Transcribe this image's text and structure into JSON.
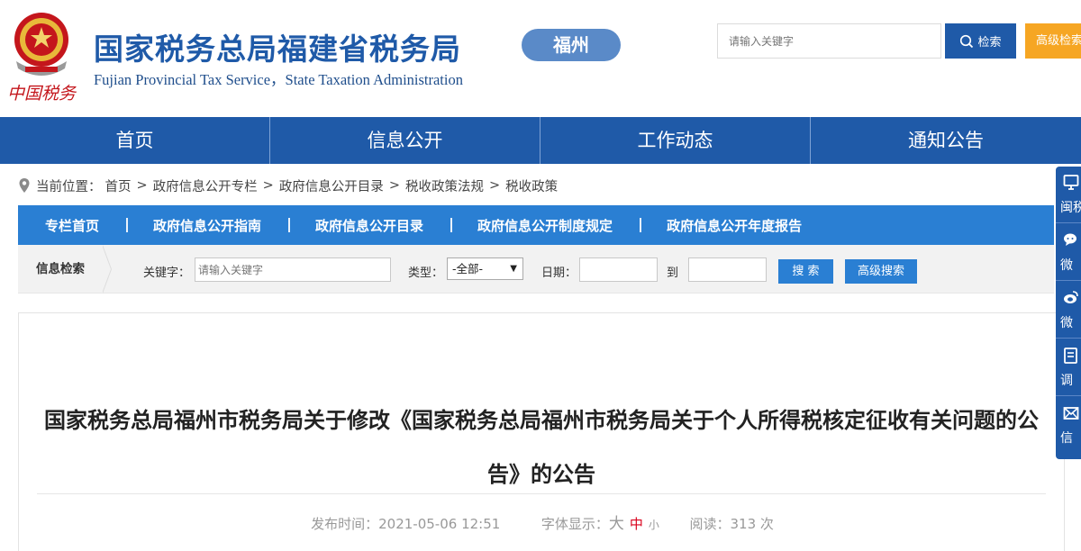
{
  "header": {
    "logo_text": "中国税务",
    "title": "国家税务总局福建省税务局",
    "subtitle": "Fujian Provincial Tax Service，State Taxation Administration",
    "city_badge": "福州",
    "search": {
      "placeholder": "请输入关键字",
      "button_label": "检索",
      "advanced_label": "高级检索"
    }
  },
  "nav": {
    "items": [
      "首页",
      "信息公开",
      "工作动态",
      "通知公告"
    ]
  },
  "breadcrumb": {
    "prefix": "当前位置：",
    "items": [
      "首页",
      "政府信息公开专栏",
      "政府信息公开目录",
      "税收政策法规",
      "税收政策"
    ],
    "separator": ">"
  },
  "subnav": {
    "items": [
      "专栏首页",
      "政府信息公开指南",
      "政府信息公开目录",
      "政府信息公开制度规定",
      "政府信息公开年度报告"
    ]
  },
  "info_search": {
    "label": "信息检索",
    "keyword_label": "关键字：",
    "keyword_placeholder": "请输入关键字",
    "type_label": "类型：",
    "type_selected": "-全部-",
    "date_label": "日期：",
    "date_to_label": "到",
    "search_button": "搜 索",
    "advanced_button": "高级搜索"
  },
  "article": {
    "title": "国家税务总局福州市税务局关于修改《国家税务总局福州市税务局关于个人所得税核定征收有关问题的公告》的公告",
    "publish_label": "发布时间：",
    "publish_time": "2021-05-06 12:51",
    "font_label": "字体显示：",
    "font_large": "大",
    "font_medium": "中",
    "font_small": "小",
    "reads_label": "阅读：",
    "reads_value": "313 次"
  },
  "floatbar": {
    "items": [
      {
        "label": "闽税",
        "icon": "monitor-icon"
      },
      {
        "label": "微",
        "icon": "chat-bubble-icon"
      },
      {
        "label": "微",
        "icon": "weibo-icon"
      },
      {
        "label": "调",
        "icon": "survey-icon"
      },
      {
        "label": "信",
        "icon": "mail-icon"
      }
    ]
  },
  "colors": {
    "primary": "#1f5aa8",
    "subnav": "#2a7fd3",
    "accent_orange": "#f6a623",
    "badge": "#5a8ac8",
    "active_red": "#d9001b"
  }
}
